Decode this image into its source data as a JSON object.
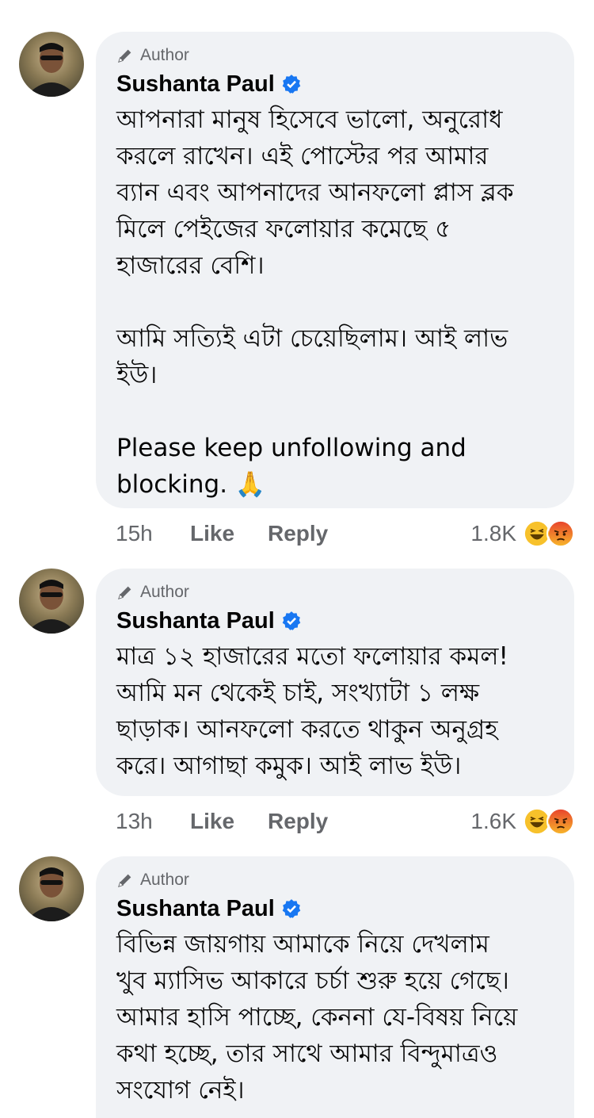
{
  "comments": [
    {
      "author_badge": "Author",
      "name": "Sushanta Paul",
      "text": "আপনারা মানুষ হিসেবে ভালো, অনুরোধ\nকরলে রাখেন। এই পোস্টের পর আমার\nব্যান এবং আপনাদের আনফলো প্লাস ব্লক\nমিলে পেইজের ফলোয়ার কমেছে ৫\nহাজারের বেশি।\n\nআমি সত্যিই এটা চেয়েছিলাম। আই লাভ\nইউ।\n\nPlease keep unfollowing and\nblocking. 🙏",
      "time": "15h",
      "like": "Like",
      "reply": "Reply",
      "reaction_count": "1.8K",
      "reactions": [
        "haha-icon",
        "angry-icon"
      ]
    },
    {
      "author_badge": "Author",
      "name": "Sushanta Paul",
      "text": "মাত্র ১২ হাজারের মতো ফলোয়ার কমল!\nআমি মন থেকেই চাই, সংখ্যাটা ১ লক্ষ\nছাড়াক। আনফলো করতে থাকুন অনুগ্রহ\nকরে। আগাছা কমুক। আই লাভ ইউ।",
      "time": "13h",
      "like": "Like",
      "reply": "Reply",
      "reaction_count": "1.6K",
      "reactions": [
        "haha-icon",
        "angry-icon"
      ]
    },
    {
      "author_badge": "Author",
      "name": "Sushanta Paul",
      "text": "বিভিন্ন জায়গায় আমাকে নিয়ে দেখলাম\nখুব ম্যাসিভ আকারে চর্চা শুরু হয়ে গেছে।\nআমার হাসি পাচ্ছে, কেননা যে-বিষয় নিয়ে\nকথা হচ্ছে, তার সাথে আমার বিন্দুমাত্রও\nসংযোগ নেই।"
    }
  ],
  "colors": {
    "bubble": "#f0f2f5",
    "verified": "#1877f2",
    "meta": "#65676b"
  }
}
